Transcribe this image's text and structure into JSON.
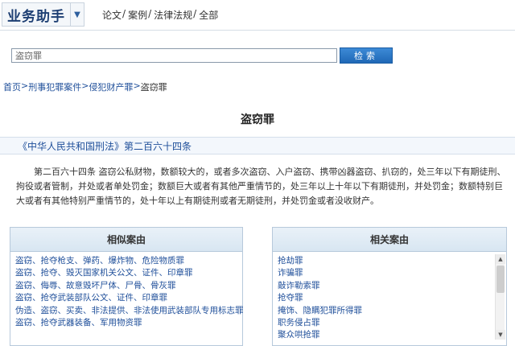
{
  "header": {
    "brand": "业务助手",
    "brand_arrow_icon": "chevron-down-icon",
    "nav": [
      {
        "label": "论文"
      },
      {
        "label": "案例"
      },
      {
        "label": "法律法规"
      },
      {
        "label": "全部"
      }
    ],
    "nav_sep": "/"
  },
  "search": {
    "value": "盗窃罪",
    "button_label": "检索"
  },
  "breadcrumb": {
    "items": [
      "首页",
      "刑事犯罪案件",
      "侵犯财产罪"
    ],
    "current": "盗窃罪",
    "sep": ">"
  },
  "page_title": "盗窃罪",
  "article": {
    "heading": "《中华人民共和国刑法》第二百六十四条",
    "body": "第二百六十四条 盗窃公私财物，数额较大的，或者多次盗窃、入户盗窃、携带凶器盗窃、扒窃的，处三年以下有期徒刑、拘役或者管制，并处或者单处罚金；数额巨大或者有其他严重情节的，处三年以上十年以下有期徒刑，并处罚金；数额特别巨大或者有其他特别严重情节的，处十年以上有期徒刑或者无期徒刑，并处罚金或者没收财产。"
  },
  "similar": {
    "title": "相似案由",
    "items": [
      "盗窃、抢夺枪支、弹药、爆炸物、危险物质罪",
      "盗窃、抢夺、毁灭国家机关公文、证件、印章罪",
      "盗窃、侮辱、故意毁坏尸体、尸骨、骨灰罪",
      "盗窃、抢夺武装部队公文、证件、印章罪",
      "伪造、盗窃、买卖、非法提供、非法使用武装部队专用标志罪",
      "盗窃、抢夺武器装备、军用物资罪"
    ]
  },
  "related": {
    "title": "相关案由",
    "items": [
      "抢劫罪",
      "诈骗罪",
      "敲诈勒索罪",
      "抢夺罪",
      "掩饰、隐瞒犯罪所得罪",
      "职务侵占罪",
      "聚众哄抢罪"
    ]
  }
}
